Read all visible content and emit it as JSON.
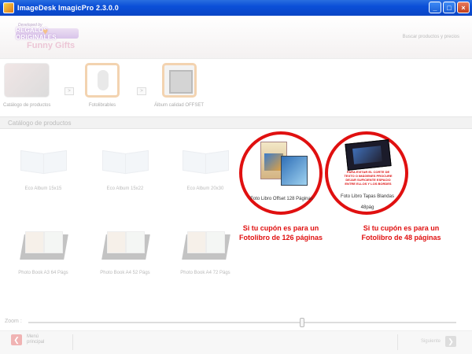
{
  "window": {
    "title": "ImageDesk ImagicPro 2.3.0.0",
    "buttons": {
      "minimize": "_",
      "maximize": "□",
      "close": "×"
    }
  },
  "header": {
    "logo": {
      "developed_by": "Developed by",
      "brand": "REGALOS  ORIGINALES",
      "sub": "Funny Gifts"
    },
    "search_link": "Buscar productos y precios"
  },
  "steps": [
    {
      "label": "Catálogo de productos"
    },
    {
      "label": "Fotolibrables"
    },
    {
      "label": "Álbum calidad OFFSET"
    }
  ],
  "section_title": "Catálogo de productos",
  "products": {
    "row1": [
      {
        "label": "Eco Album 15x15"
      },
      {
        "label": "Eco Album 15x22"
      },
      {
        "label": "Eco Album 20x30"
      },
      {
        "label": "Foto Libro Offset 128 Páginas"
      },
      {
        "label_line1": "Foto Libro Tapas Blandas",
        "label_line2": "48pág",
        "warning": "PARA EVITAR EL CORTE DE TEXTO O IMÁGENES PROCURE DEJAR SUFICIENTE ESPACIO ENTRE ELLOS Y LOS BORDES"
      }
    ],
    "row2": [
      {
        "label": "Photo Book A3 64 Págs"
      },
      {
        "label": "Photo Book A4 52 Págs"
      },
      {
        "label": "Photo Book A4 72 Págs"
      }
    ]
  },
  "callouts": {
    "left_line1": "Si tu cupón es para un",
    "left_line2": "Fotolibro de 126 páginas",
    "right_line1": "Si tu cupón es para un",
    "right_line2": "Fotolibro de 48 páginas"
  },
  "zoom": {
    "label": "Zoom :",
    "level": 0.64
  },
  "footer": {
    "back_line1": "Menú",
    "back_line2": "principal",
    "next_label": "Siguiente"
  },
  "colors": {
    "titlebar": "#0b4fd8",
    "callout_red": "#e01010"
  }
}
